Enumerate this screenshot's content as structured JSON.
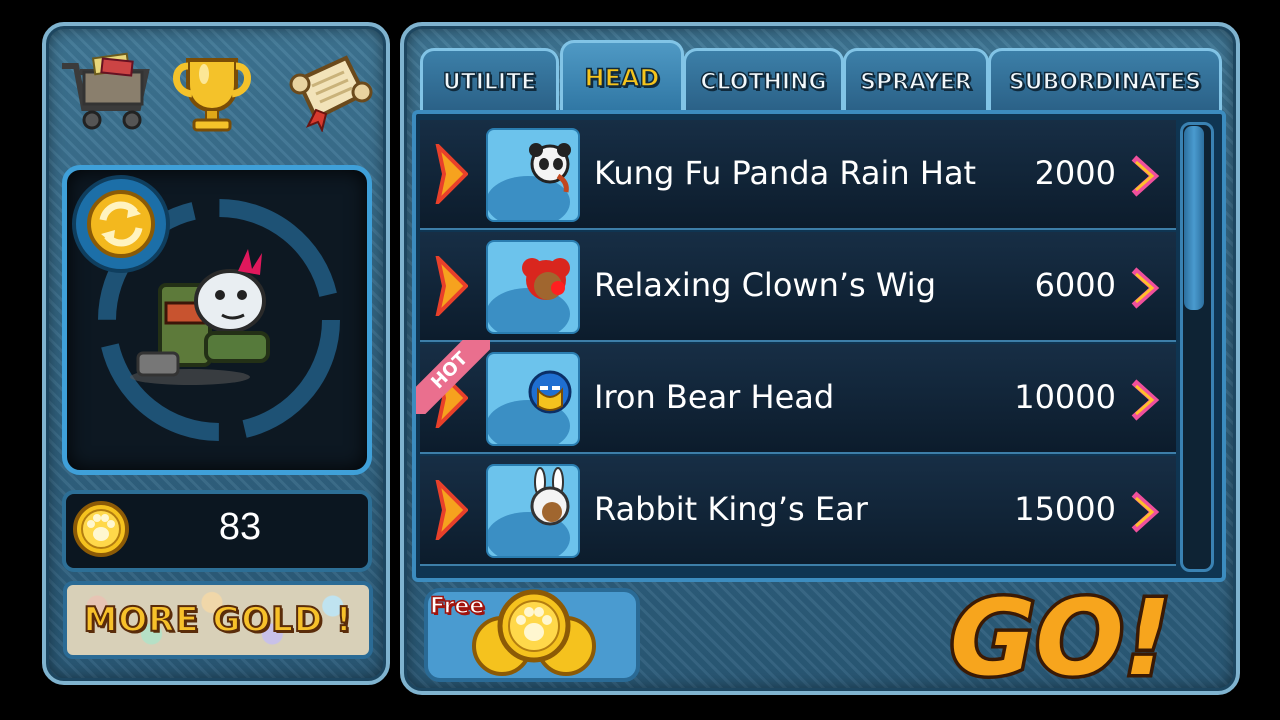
{
  "tabs": [
    {
      "label": "UTILITE",
      "active": false
    },
    {
      "label": "HEAD",
      "active": true
    },
    {
      "label": "CLOTHING",
      "active": false
    },
    {
      "label": "SPRAYER",
      "active": false
    },
    {
      "label": "SUBORDINATES",
      "active": false
    }
  ],
  "items": [
    {
      "name": "Kung Fu Panda Rain Hat",
      "price": "2000",
      "hot": false,
      "icon": "panda-hat-icon"
    },
    {
      "name": "Relaxing Clown’s Wig",
      "price": "6000",
      "hot": false,
      "icon": "clown-wig-icon"
    },
    {
      "name": "Iron Bear Head",
      "price": "10000",
      "hot": true,
      "icon": "iron-bear-icon"
    },
    {
      "name": "Rabbit King’s Ear",
      "price": "15000",
      "hot": false,
      "icon": "rabbit-ear-icon"
    }
  ],
  "hot_label": "HOT",
  "gold": {
    "value": "83"
  },
  "more_gold": {
    "label": "MORE GOLD !"
  },
  "free": {
    "label": "Free"
  },
  "go": {
    "label": "GO!"
  },
  "colors": {
    "accent": "#3fa0d9",
    "gold": "#f5c41c",
    "panel": "#2f6585",
    "hot": "#ea6f8e"
  }
}
